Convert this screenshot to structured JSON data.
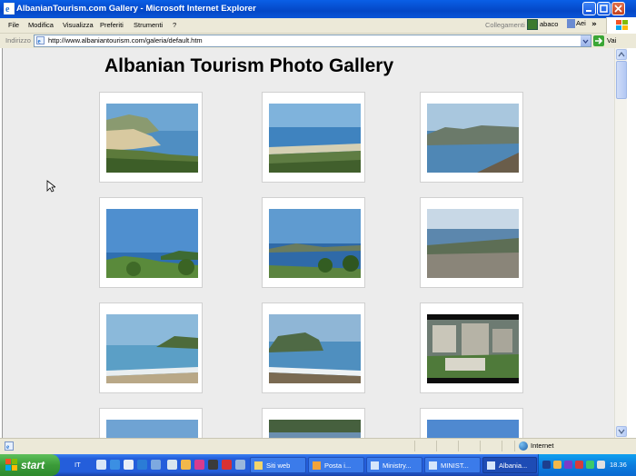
{
  "window": {
    "title": "AlbanianTourism.com Gallery - Microsoft Internet Explorer"
  },
  "menu": {
    "items": [
      "File",
      "Modifica",
      "Visualizza",
      "Preferiti",
      "Strumenti",
      "?"
    ],
    "links_label": "Collegamenti",
    "links": [
      "abaco",
      "Aei"
    ],
    "chevron": "»"
  },
  "address": {
    "label": "Indirizzo",
    "url": "http://www.albaniantourism.com/galeria/default.htm",
    "go_label": "Vai"
  },
  "page": {
    "title": "Albanian Tourism Photo Gallery"
  },
  "gallery": {
    "photos": [
      {
        "subject": "bay with beach and green headland"
      },
      {
        "subject": "long sandy beach and blue sea"
      },
      {
        "subject": "coastal mountains over a bay"
      },
      {
        "subject": "sea view with small islands"
      },
      {
        "subject": "bay with pine trees"
      },
      {
        "subject": "rocky coastline"
      },
      {
        "subject": "sea and headland"
      },
      {
        "subject": "waves on a rocky beach"
      },
      {
        "subject": "ancient stone ruins"
      },
      {
        "subject": "sky"
      },
      {
        "subject": "trees"
      },
      {
        "subject": "sky"
      }
    ]
  },
  "status": {
    "zone": "Internet"
  },
  "taskbar": {
    "start_label": "start",
    "language": "IT",
    "tasks": [
      {
        "label": "Siti web",
        "icon": "folder-icon",
        "active": false
      },
      {
        "label": "Posta i...",
        "icon": "mail-icon",
        "active": false
      },
      {
        "label": "Ministry...",
        "icon": "ie-icon",
        "active": false
      },
      {
        "label": "MINIST...",
        "icon": "ie-icon",
        "active": false
      },
      {
        "label": "Albania...",
        "icon": "ie-icon",
        "active": true
      }
    ],
    "clock": "18.36"
  }
}
